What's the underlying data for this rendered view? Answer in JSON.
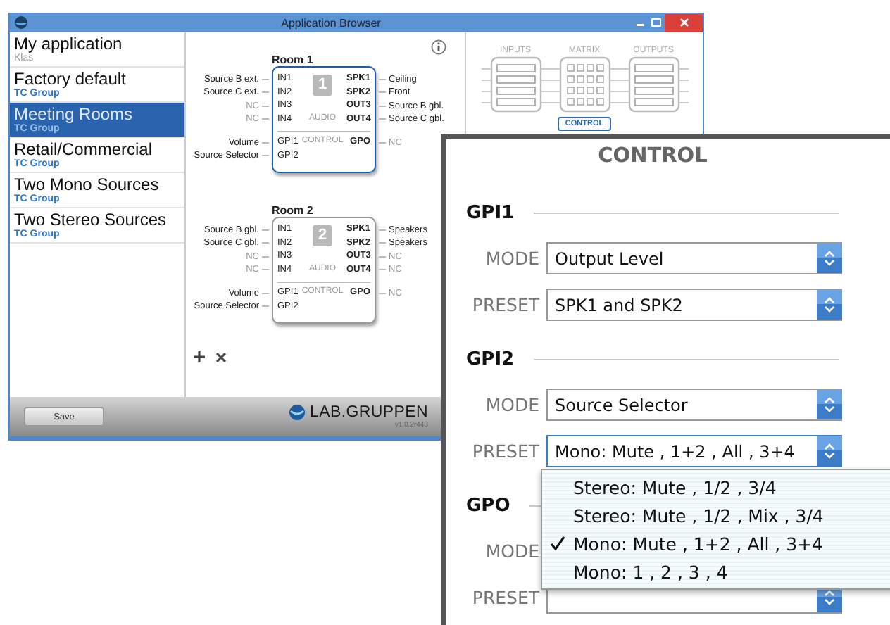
{
  "window": {
    "title": "Application Browser"
  },
  "sidebar": {
    "items": [
      {
        "title": "My application",
        "subtitle": "Klas",
        "kind": "user",
        "selected": false
      },
      {
        "title": "Factory default",
        "subtitle": "TC Group",
        "kind": "group",
        "selected": false
      },
      {
        "title": "Meeting Rooms",
        "subtitle": "TC Group",
        "kind": "group",
        "selected": true
      },
      {
        "title": "Retail/Commercial",
        "subtitle": "TC Group",
        "kind": "group",
        "selected": false
      },
      {
        "title": "Two Mono Sources",
        "subtitle": "TC Group",
        "kind": "group",
        "selected": false
      },
      {
        "title": "Two Stereo Sources",
        "subtitle": "TC Group",
        "kind": "group",
        "selected": false
      }
    ]
  },
  "rooms": [
    {
      "title": "Room 1",
      "number": "1",
      "selected": true,
      "audio_label": "AUDIO",
      "control_label": "CONTROL",
      "inputs": [
        {
          "source": "Source B ext.",
          "port": "IN1",
          "connected": true
        },
        {
          "source": "Source C ext.",
          "port": "IN2",
          "connected": true
        },
        {
          "source": "NC",
          "port": "IN3",
          "connected": false
        },
        {
          "source": "NC",
          "port": "IN4",
          "connected": false
        }
      ],
      "outputs": [
        {
          "port": "SPK1",
          "target": "Ceiling",
          "connected": true
        },
        {
          "port": "SPK2",
          "target": "Front",
          "connected": true
        },
        {
          "port": "OUT3",
          "target": "Source B gbl.",
          "connected": true
        },
        {
          "port": "OUT4",
          "target": "Source C gbl.",
          "connected": true
        }
      ],
      "control_inputs": [
        {
          "source": "Volume",
          "port": "GPI1",
          "connected": true
        },
        {
          "source": "Source Selector",
          "port": "GPI2",
          "connected": true
        }
      ],
      "control_outputs": [
        {
          "port": "GPO",
          "target": "NC",
          "connected": false
        }
      ]
    },
    {
      "title": "Room 2",
      "number": "2",
      "selected": false,
      "audio_label": "AUDIO",
      "control_label": "CONTROL",
      "inputs": [
        {
          "source": "Source B gbl.",
          "port": "IN1",
          "connected": true
        },
        {
          "source": "Source C gbl.",
          "port": "IN2",
          "connected": true
        },
        {
          "source": "NC",
          "port": "IN3",
          "connected": false
        },
        {
          "source": "NC",
          "port": "IN4",
          "connected": false
        }
      ],
      "outputs": [
        {
          "port": "SPK1",
          "target": "Speakers",
          "connected": true
        },
        {
          "port": "SPK2",
          "target": "Speakers",
          "connected": true
        },
        {
          "port": "OUT3",
          "target": "NC",
          "connected": false
        },
        {
          "port": "OUT4",
          "target": "NC",
          "connected": false
        }
      ],
      "control_inputs": [
        {
          "source": "Volume",
          "port": "GPI1",
          "connected": true
        },
        {
          "source": "Source Selector",
          "port": "GPI2",
          "connected": true
        }
      ],
      "control_outputs": [
        {
          "port": "GPO",
          "target": "NC",
          "connected": false
        }
      ]
    }
  ],
  "signal_flow": {
    "stages": [
      {
        "label": "INPUTS",
        "kind": "bank"
      },
      {
        "label": "MATRIX",
        "kind": "grid"
      },
      {
        "label": "OUTPUTS",
        "kind": "bank"
      }
    ],
    "control_button": {
      "label": "CONTROL",
      "selected": true
    }
  },
  "footer": {
    "save_button": "Save",
    "logo": "LAB.GRUPPEN",
    "version": "v1.0.2r443"
  },
  "control_panel": {
    "title": "CONTROL",
    "sections": [
      {
        "title": "GPI1",
        "fields": [
          {
            "label": "MODE",
            "value": "Output Level",
            "focused": false
          },
          {
            "label": "PRESET",
            "value": "SPK1 and SPK2",
            "focused": false
          }
        ]
      },
      {
        "title": "GPI2",
        "fields": [
          {
            "label": "MODE",
            "value": "Source Selector",
            "focused": false
          },
          {
            "label": "PRESET",
            "value": "Mono: Mute , 1+2 , All , 3+4",
            "focused": true,
            "options": [
              {
                "label": "Stereo: Mute , 1/2 , 3/4",
                "selected": false
              },
              {
                "label": "Stereo: Mute , 1/2 , Mix , 3/4",
                "selected": false
              },
              {
                "label": "Mono: Mute , 1+2 , All , 3+4",
                "selected": true
              },
              {
                "label": "Mono: 1 , 2 , 3 , 4",
                "selected": false
              }
            ]
          }
        ]
      },
      {
        "title": "GPO",
        "fields": [
          {
            "label": "MODE"
          },
          {
            "label": "PRESET"
          }
        ]
      }
    ]
  }
}
